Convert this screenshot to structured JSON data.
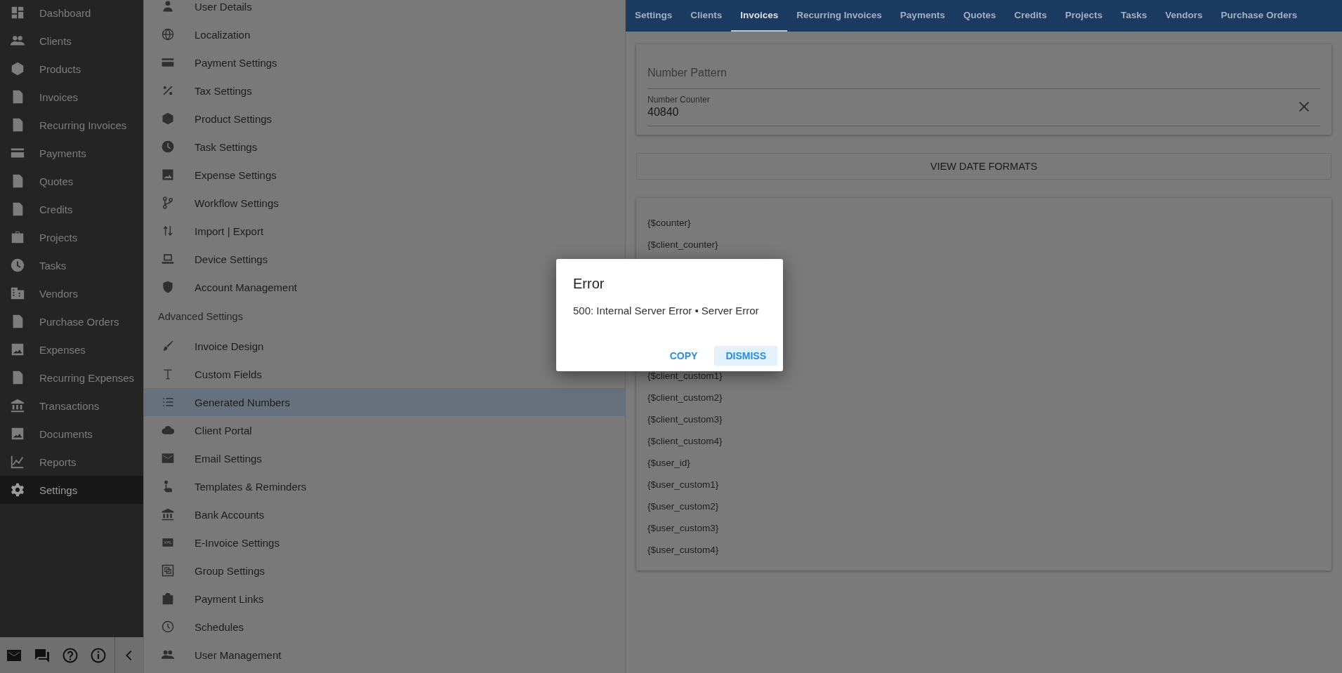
{
  "sidebar": {
    "items": [
      {
        "label": "Dashboard",
        "selected": false
      },
      {
        "label": "Clients",
        "selected": false
      },
      {
        "label": "Products",
        "selected": false
      },
      {
        "label": "Invoices",
        "selected": false
      },
      {
        "label": "Recurring Invoices",
        "selected": false
      },
      {
        "label": "Payments",
        "selected": false
      },
      {
        "label": "Quotes",
        "selected": false
      },
      {
        "label": "Credits",
        "selected": false
      },
      {
        "label": "Projects",
        "selected": false
      },
      {
        "label": "Tasks",
        "selected": false
      },
      {
        "label": "Vendors",
        "selected": false
      },
      {
        "label": "Purchase Orders",
        "selected": false
      },
      {
        "label": "Expenses",
        "selected": false
      },
      {
        "label": "Recurring Expenses",
        "selected": false
      },
      {
        "label": "Transactions",
        "selected": false
      },
      {
        "label": "Documents",
        "selected": false
      },
      {
        "label": "Reports",
        "selected": false
      },
      {
        "label": "Settings",
        "selected": true
      }
    ]
  },
  "settings_menu": {
    "sections": [
      {
        "items": [
          {
            "label": "User Details",
            "selected": false
          },
          {
            "label": "Localization",
            "selected": false
          },
          {
            "label": "Payment Settings",
            "selected": false
          },
          {
            "label": "Tax Settings",
            "selected": false
          },
          {
            "label": "Product Settings",
            "selected": false
          },
          {
            "label": "Task Settings",
            "selected": false
          },
          {
            "label": "Expense Settings",
            "selected": false
          },
          {
            "label": "Workflow Settings",
            "selected": false
          },
          {
            "label": "Import | Export",
            "selected": false
          },
          {
            "label": "Device Settings",
            "selected": false
          },
          {
            "label": "Account Management",
            "selected": false
          }
        ]
      },
      {
        "heading": "Advanced Settings",
        "items": [
          {
            "label": "Invoice Design",
            "selected": false
          },
          {
            "label": "Custom Fields",
            "selected": false
          },
          {
            "label": "Generated Numbers",
            "selected": true
          },
          {
            "label": "Client Portal",
            "selected": false
          },
          {
            "label": "Email Settings",
            "selected": false
          },
          {
            "label": "Templates & Reminders",
            "selected": false
          },
          {
            "label": "Bank Accounts",
            "selected": false
          },
          {
            "label": "E-Invoice Settings",
            "selected": false
          },
          {
            "label": "Group Settings",
            "selected": false
          },
          {
            "label": "Payment Links",
            "selected": false
          },
          {
            "label": "Schedules",
            "selected": false
          },
          {
            "label": "User Management",
            "selected": false
          }
        ]
      }
    ]
  },
  "tabs": [
    {
      "label": "Settings",
      "selected": false
    },
    {
      "label": "Clients",
      "selected": false
    },
    {
      "label": "Invoices",
      "selected": true
    },
    {
      "label": "Recurring Invoices",
      "selected": false
    },
    {
      "label": "Payments",
      "selected": false
    },
    {
      "label": "Quotes",
      "selected": false
    },
    {
      "label": "Credits",
      "selected": false
    },
    {
      "label": "Projects",
      "selected": false
    },
    {
      "label": "Tasks",
      "selected": false
    },
    {
      "label": "Vendors",
      "selected": false
    },
    {
      "label": "Purchase Orders",
      "selected": false
    }
  ],
  "number_pattern": {
    "placeholder": "Number Pattern"
  },
  "number_counter": {
    "label": "Number Counter",
    "value": "40840"
  },
  "view_date_formats_button": "VIEW DATE FORMATS",
  "variables_top": [
    "{$counter}",
    "{$client_counter}"
  ],
  "variables_bottom": [
    "{$client_custom1}",
    "{$client_custom2}",
    "{$client_custom3}",
    "{$client_custom4}",
    "{$user_id}",
    "{$user_custom1}",
    "{$user_custom2}",
    "{$user_custom3}",
    "{$user_custom4}"
  ],
  "dialog": {
    "title": "Error",
    "message": "500: Internal Server Error • Server Error",
    "buttons": [
      {
        "label": "COPY",
        "kind": "text"
      },
      {
        "label": "DISMISS",
        "kind": "tonal"
      }
    ]
  }
}
